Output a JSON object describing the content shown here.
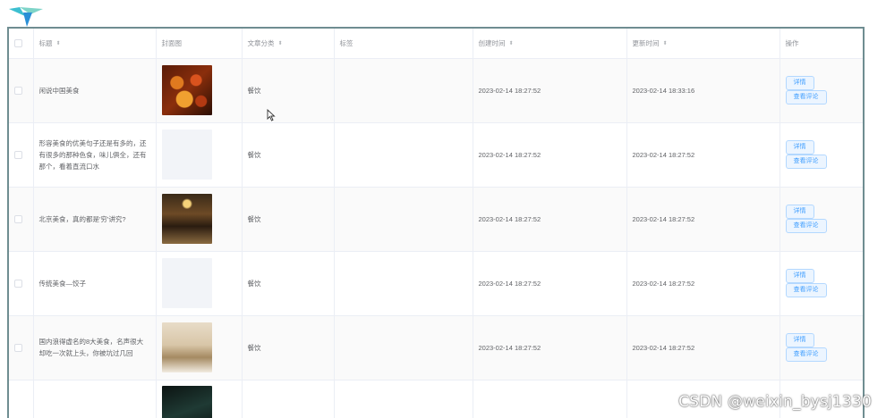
{
  "header": {
    "select_all": "",
    "columns": [
      {
        "key": "title",
        "label": "标题",
        "sortable": true
      },
      {
        "key": "cover",
        "label": "封面图",
        "sortable": false
      },
      {
        "key": "category",
        "label": "文章分类",
        "sortable": true
      },
      {
        "key": "tags",
        "label": "标签",
        "sortable": false
      },
      {
        "key": "created",
        "label": "创建时间",
        "sortable": true
      },
      {
        "key": "updated",
        "label": "更新时间",
        "sortable": true
      },
      {
        "key": "actions",
        "label": "操作",
        "sortable": false
      }
    ]
  },
  "rows": [
    {
      "title": "闲说中国美食",
      "cover": "food",
      "category": "餐饮",
      "tags": "",
      "created": "2023-02-14 18:27:52",
      "updated": "2023-02-14 18:33:16",
      "detail": "详情",
      "comments": "查看评论"
    },
    {
      "title": "形容美食的优美句子还是有多的，还有很多的那种色食，味儿俱全，还有那个，看着直流口水",
      "cover": "blank",
      "category": "餐饮",
      "tags": "",
      "created": "2023-02-14 18:27:52",
      "updated": "2023-02-14 18:27:52",
      "detail": "详情",
      "comments": "查看评论"
    },
    {
      "title": "北京美食，真的都是'穷'讲究?",
      "cover": "rest",
      "category": "餐饮",
      "tags": "",
      "created": "2023-02-14 18:27:52",
      "updated": "2023-02-14 18:27:52",
      "detail": "详情",
      "comments": "查看评论"
    },
    {
      "title": "传统美食—饺子",
      "cover": "blank",
      "category": "餐饮",
      "tags": "",
      "created": "2023-02-14 18:27:52",
      "updated": "2023-02-14 18:27:52",
      "detail": "详情",
      "comments": "查看评论"
    },
    {
      "title": "国内浪得虚名的8大美食，名声很大却吃一次就上头，你被坑过几回",
      "cover": "room",
      "category": "餐饮",
      "tags": "",
      "created": "2023-02-14 18:27:52",
      "updated": "2023-02-14 18:27:52",
      "detail": "详情",
      "comments": "查看评论"
    },
    {
      "title": "",
      "cover": "dark",
      "category": "",
      "tags": "",
      "created": "",
      "updated": "",
      "detail": "",
      "comments": ""
    }
  ],
  "icons": {
    "logo": "app-logo-icon",
    "sort": "sort-caret-icon",
    "cursor": "mouse-cursor-icon"
  },
  "colors": {
    "frame": "#6f8d91",
    "button_text": "#409eff",
    "button_bg": "#ecf5ff"
  },
  "watermark": "CSDN @weixin_bysj1330"
}
